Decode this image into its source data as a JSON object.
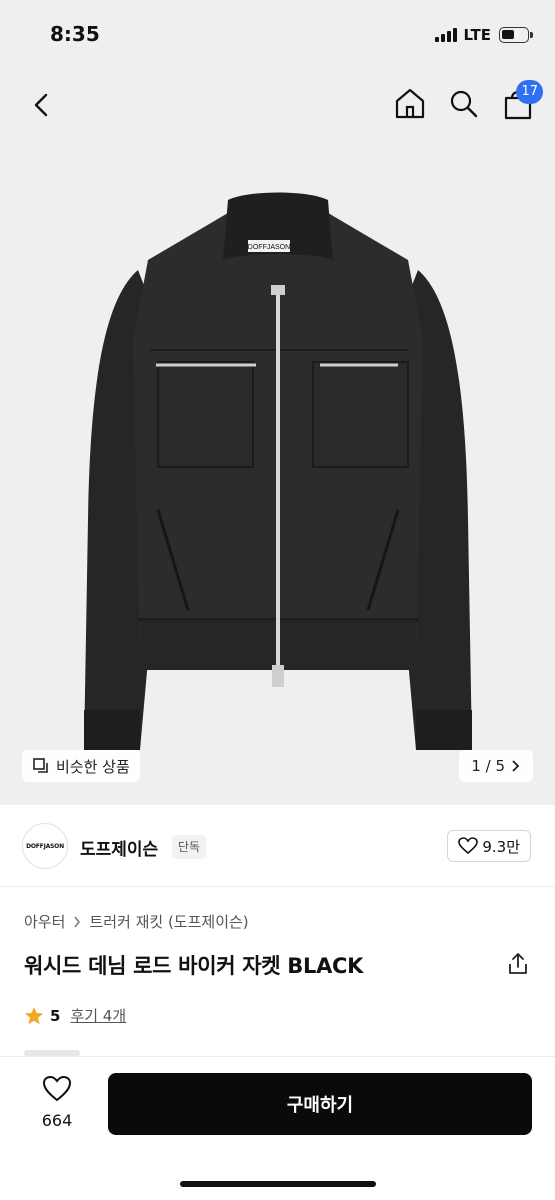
{
  "status_bar": {
    "time": "8:35",
    "network": "LTE"
  },
  "nav": {
    "cart_count": "17"
  },
  "product_image": {
    "brand_label": "DOFFJASON",
    "similar_button_label": "비슷한 상품",
    "pager": "1 / 5"
  },
  "brand": {
    "logo_text": "DOFFJASON",
    "name": "도프제이슨",
    "tag": "단독",
    "likes": "9.3만"
  },
  "breadcrumb": [
    "아우터",
    "트러커 재킷 (도프제이슨)"
  ],
  "product": {
    "title": "워시드 데님 로드 바이커 자켓 BLACK",
    "rating": "5",
    "reviews": "후기 4개"
  },
  "bottom_bar": {
    "wish_count": "664",
    "buy_label": "구매하기"
  },
  "colors": {
    "badge": "#2f6ff2",
    "star": "#f5a623",
    "buy_button": "#0a0a0a",
    "image_bg": "#efefef"
  }
}
